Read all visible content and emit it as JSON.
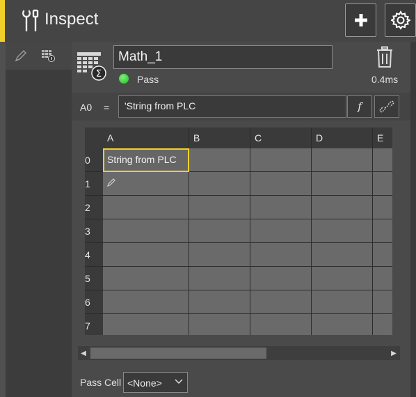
{
  "header": {
    "title": "Inspect",
    "accent_color": "#f2d02a",
    "icon": "tools-icon",
    "add_icon": "plus-icon",
    "settings_icon": "gear-icon"
  },
  "left_toolbar": {
    "edit_icon": "pencil-icon",
    "sheet_icon": "spreadsheet-info-icon"
  },
  "tool": {
    "icon": "spreadsheet-sum-icon",
    "name": "Math_1",
    "status": "Pass",
    "status_color": "#2fcf2f",
    "timing": "0.4ms",
    "delete_icon": "trash-icon"
  },
  "formula_bar": {
    "cell_ref": "A0",
    "equals": "=",
    "value": "'String from PLC",
    "function_button": "f",
    "link_icon": "unlink-icon"
  },
  "grid": {
    "columns": [
      "A",
      "B",
      "C",
      "D",
      "E"
    ],
    "rows": [
      "0",
      "1",
      "2",
      "3",
      "4",
      "5",
      "6",
      "7"
    ],
    "cells": {
      "A0": "String from PLC"
    },
    "selected_cell": "A0",
    "edit_marker_cell": "A1"
  },
  "footer": {
    "pass_cell_label": "Pass Cell",
    "pass_cell_value": "<None>"
  }
}
